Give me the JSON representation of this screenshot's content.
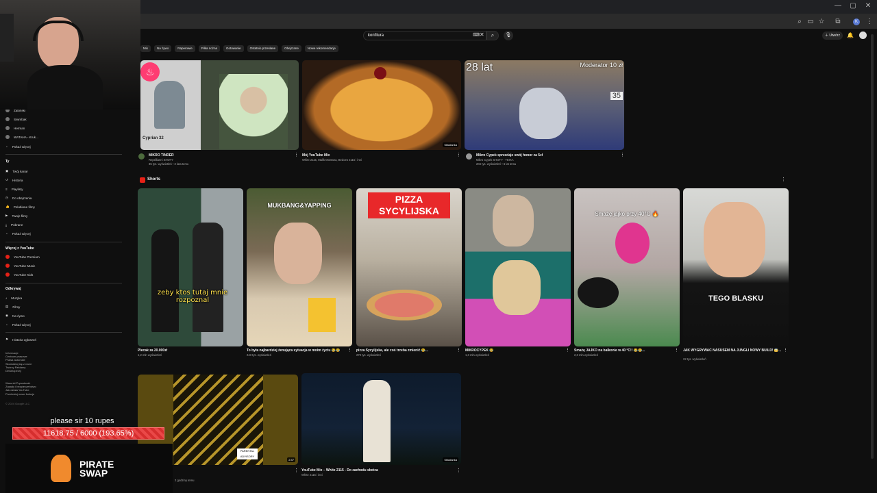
{
  "browser": {
    "window_controls": [
      "—",
      "▢",
      "✕"
    ]
  },
  "header": {
    "search_value": "konfitura",
    "create_label": "Utwórz",
    "avatar_letter": "K"
  },
  "chips": [
    "Mix",
    "Na żywo",
    "Raperowie",
    "Piłka nożna",
    "Gotowanie",
    "Ostatnio przesłane",
    "Obejrzane",
    "Nowe rekomendacje"
  ],
  "sidebar": {
    "subs": [
      "Zabiński",
      "Siwmbak",
      "Herman",
      "WATAHA - Kruk..."
    ],
    "show_more": "Pokaż więcej",
    "you_heading": "Ty",
    "you_items": [
      "Twój kanał",
      "Historia",
      "Playlisty",
      "Do obejrzenia",
      "Polubione filmy",
      "Twoje filmy",
      "Pobrane",
      "Pokaż więcej"
    ],
    "more_heading": "Więcej z YouTube",
    "more_items": [
      "YouTube Premium",
      "YouTube Music",
      "YouTube Kids"
    ],
    "explore_heading": "Odkrywaj",
    "explore_items": [
      "Muzyka",
      "Filmy",
      "Na żywo",
      "Pokaż więcej"
    ],
    "report": "Historia zgłoszeń",
    "footer1": "Informacje\nCentrum prasowe\nPrawa autorskie\nSkontaktuj się z nami\nTwórcy  Reklamy\nDeweloperzy",
    "footer2": "Warunki  Prywatność\nZasady i bezpieczeństwo\nJak działa YouTube\nPrzetestuj nowe funkcje",
    "copyright": "© 2024 Google LLC"
  },
  "videos": [
    {
      "title": "MIKRO TINDER",
      "channel": "Reptillianni SHOTY",
      "meta": "35 tys. wyświetleń • 2 lata temu",
      "tag": "Cyprian 32"
    },
    {
      "title": "Mój YouTube Mix",
      "channel": "White 2115, Malik Montana, Bedoes 2115 i inni",
      "meta": "",
      "badge": "Składanka"
    },
    {
      "title": "Mikro Cypek sprzedaje swój honor za 5zł",
      "channel": "Mikro Cypek SHOTY - TEIKA",
      "meta": "204 tys. wyświetleń • 6 lat temu",
      "overlay_left": "28 lat",
      "overlay_right": "Moderator 10 zł",
      "overlay_num": "35"
    }
  ],
  "shorts": {
    "heading": "Shorts",
    "items": [
      {
        "title": "Plecak za 20.000zł",
        "views": "1,2 mln wyświetleń",
        "caption": "zeby ktos tutaj mnie rozpoznal"
      },
      {
        "title": "To była najbardziej żenująca sytuacja w moim życiu 😂😂",
        "views": "243 tys. wyświetleń",
        "caption": "MUKBANG&YAPPING"
      },
      {
        "title": "pizza Sycylijska, ale coś trzeba zmienić 😂...",
        "views": "273 tys. wyświetleń",
        "caption": "PIZZA SYCYLIJSKA"
      },
      {
        "title": "MIKROCYPEK 😂",
        "views": "1,3 mln wyświetleń",
        "caption": ""
      },
      {
        "title": "Smażę JAJKO na balkonie w 40 °C!! 😂😂...",
        "views": "2,3 mln wyświetleń",
        "caption": "Smażę jajko przy 40°C 🔥"
      },
      {
        "title": "JAK WYGRYWAĆ NASUSEM NA JUNGLI NOWY BUILD! 😱...",
        "views": "22 tys. wyświetleń",
        "caption": "TEGO BLASKU"
      }
    ]
  },
  "row3": [
    {
      "title": "",
      "meta": "2 godziny temu",
      "duration": "2:47"
    },
    {
      "title": "YouTube Mix – White 2115 - Do zachodu słońca",
      "channel": "White 2115 i inni",
      "badge": "Składanka"
    }
  ],
  "overlay": {
    "donation_text": "please sir 10 rupes",
    "donation_progress": "11618.75 / 6000 (193.65%)",
    "donation_fraction": 1.0,
    "logo_line1": "PIRATE",
    "logo_line2": "SWAP"
  }
}
